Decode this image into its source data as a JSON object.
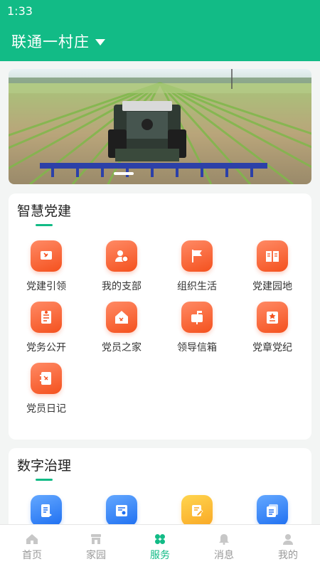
{
  "status_bar": {
    "time": "1:33"
  },
  "header": {
    "village_name": "联通一村庄",
    "accent_color": "#12bb86"
  },
  "banner": {
    "image": "tractor-in-field"
  },
  "sections": [
    {
      "title": "智慧党建",
      "items": [
        {
          "label": "党建引领",
          "icon": "party-flag-icon",
          "color": "#f4511e"
        },
        {
          "label": "我的支部",
          "icon": "member-badge-icon",
          "color": "#f4511e"
        },
        {
          "label": "组织生活",
          "icon": "waving-flag-icon",
          "color": "#f4511e"
        },
        {
          "label": "党建园地",
          "icon": "open-book-icon",
          "color": "#f4511e"
        },
        {
          "label": "党务公开",
          "icon": "notice-document-icon",
          "color": "#f4511e"
        },
        {
          "label": "党员之家",
          "icon": "party-home-icon",
          "color": "#f4511e"
        },
        {
          "label": "领导信箱",
          "icon": "mailbox-icon",
          "color": "#f4511e"
        },
        {
          "label": "党章党纪",
          "icon": "party-charter-icon",
          "color": "#f4511e"
        },
        {
          "label": "党员日记",
          "icon": "diary-icon",
          "color": "#f4511e"
        }
      ]
    },
    {
      "title": "数字治理",
      "items": [
        {
          "label": "",
          "icon": "document-play-icon",
          "color": "#1e6ff1"
        },
        {
          "label": "",
          "icon": "id-card-icon",
          "color": "#1e6ff1"
        },
        {
          "label": "",
          "icon": "edit-note-icon",
          "color": "#f9a825"
        },
        {
          "label": "",
          "icon": "document-list-icon",
          "color": "#1e6ff1"
        }
      ]
    }
  ],
  "tabbar": {
    "tabs": [
      {
        "label": "首页",
        "icon": "home-icon",
        "active": false
      },
      {
        "label": "家园",
        "icon": "store-icon",
        "active": false
      },
      {
        "label": "服务",
        "icon": "clover-icon",
        "active": true
      },
      {
        "label": "消息",
        "icon": "bell-icon",
        "active": false
      },
      {
        "label": "我的",
        "icon": "user-icon",
        "active": false
      }
    ]
  }
}
